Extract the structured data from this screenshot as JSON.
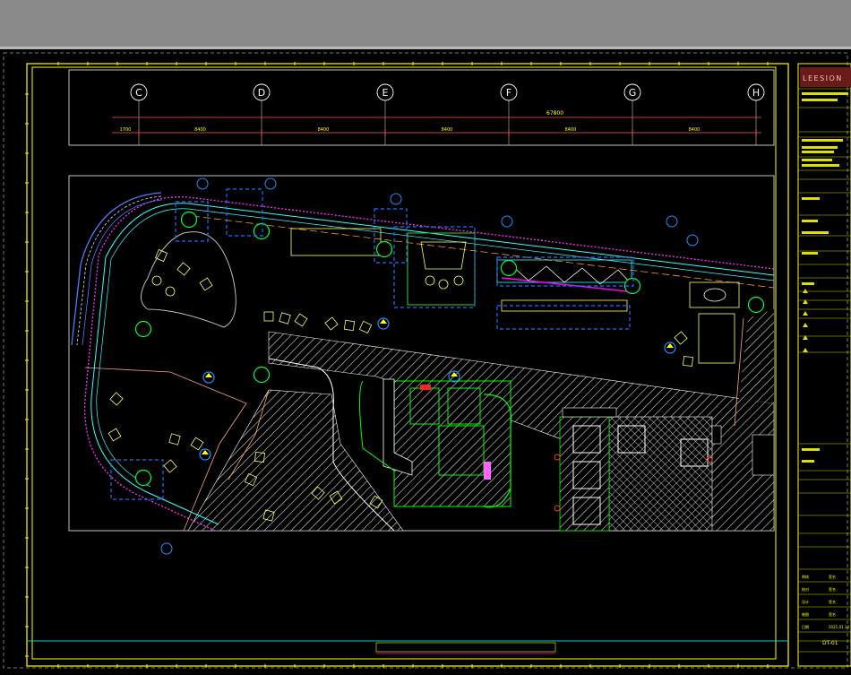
{
  "grid_axes": [
    "C",
    "D",
    "E",
    "F",
    "G",
    "H"
  ],
  "dimensions": {
    "overall": "67800",
    "spans": [
      "1700",
      "8400",
      "8400",
      "8400",
      "8400",
      "8400"
    ]
  },
  "title_block": {
    "logo": "LEESION",
    "sheet_number": "DT-01",
    "rows": [
      "审核",
      "校对",
      "设计",
      "制图",
      "日期"
    ],
    "values": [
      "签名",
      "签名",
      "签名",
      "签名",
      "2021.01.14"
    ]
  },
  "colors": {
    "background": "#000000",
    "sheet_frame": "#ffff00",
    "dimension_line": "#ff3333",
    "wall_outline": "#00ff00",
    "hatch": "#ffffff",
    "tag": "#1f6fff",
    "curtain": "#ff00ff",
    "furniture": "#ffff66"
  }
}
